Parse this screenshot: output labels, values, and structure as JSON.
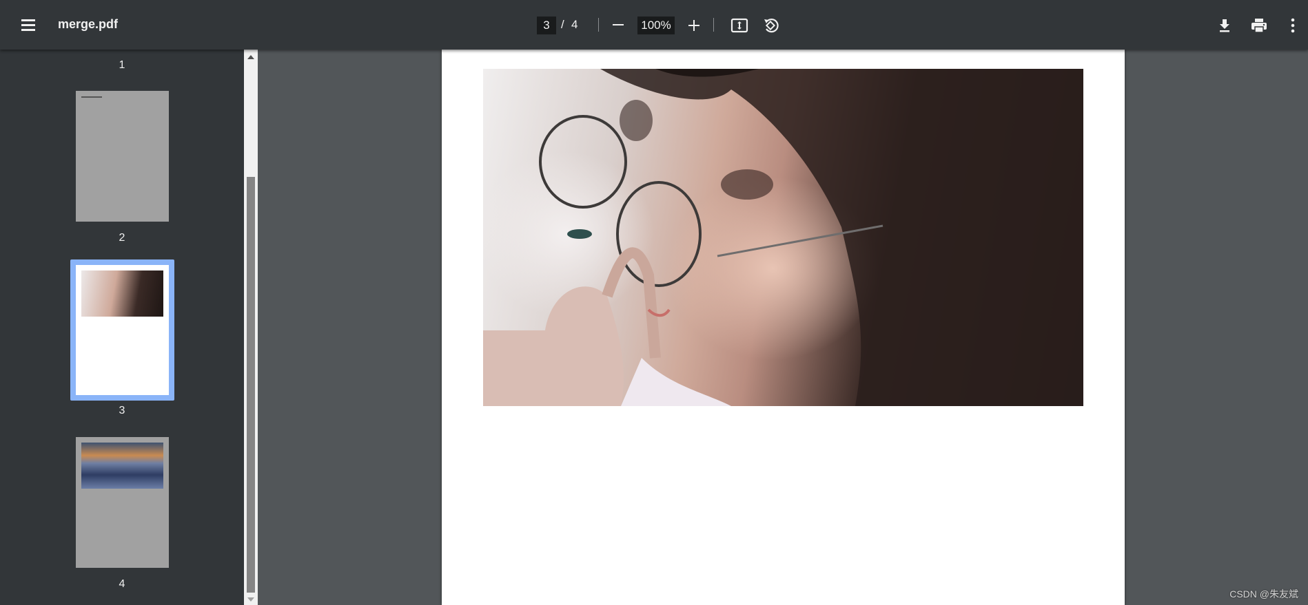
{
  "toolbar": {
    "title": "merge.pdf",
    "current_page": "3",
    "page_separator": "/",
    "total_pages": "4",
    "zoom": "100%",
    "menu_icon": "hamburger-menu-icon",
    "zoom_out_icon": "minus-icon",
    "zoom_in_icon": "plus-icon",
    "fit_icon": "fit-to-page-icon",
    "rotate_icon": "rotate-counterclockwise-icon",
    "download_icon": "download-icon",
    "print_icon": "print-icon",
    "more_icon": "more-vert-icon"
  },
  "sidebar": {
    "thumbnails": [
      {
        "label": "1"
      },
      {
        "label": "2"
      },
      {
        "label": "3",
        "selected": true
      },
      {
        "label": "4"
      }
    ],
    "selected_border_color": "#8ab4f8"
  },
  "watermark": "CSDN @朱友斌"
}
